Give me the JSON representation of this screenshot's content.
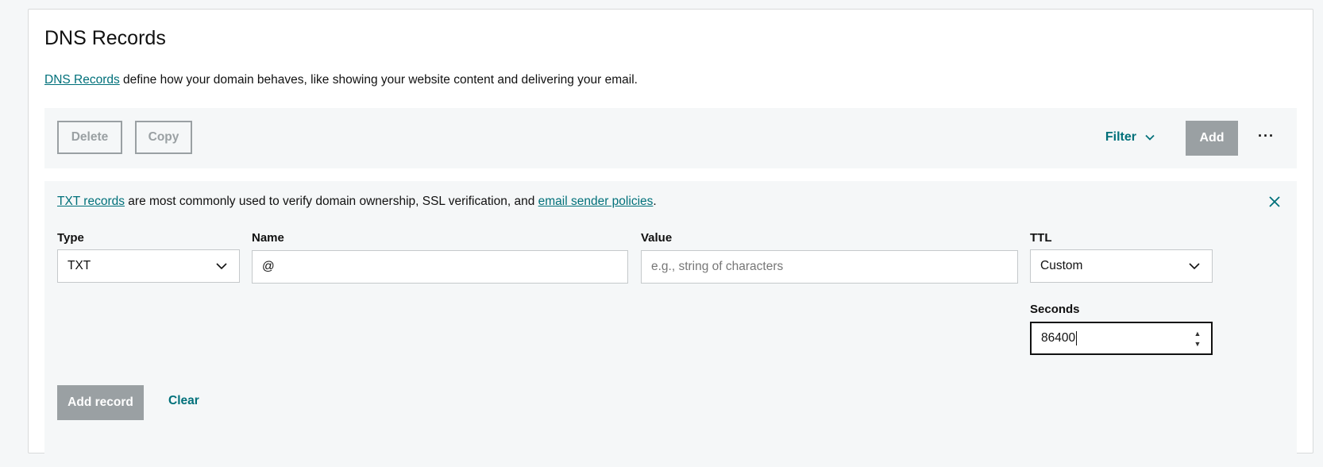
{
  "header": {
    "title": "DNS Records",
    "desc_link": "DNS Records",
    "desc_text": " define how your domain behaves, like showing your website content and delivering your email."
  },
  "toolbar": {
    "delete_label": "Delete",
    "copy_label": "Copy",
    "filter_label": "Filter",
    "add_label": "Add",
    "more_label": "···"
  },
  "banner": {
    "link1": "TXT records",
    "text1": " are most commonly used to verify domain ownership, SSL verification, and ",
    "link2": "email sender policies",
    "text2": "."
  },
  "form": {
    "type_label": "Type",
    "type_value": "TXT",
    "name_label": "Name",
    "name_value": "@",
    "value_label": "Value",
    "value_placeholder": "e.g., string of characters",
    "ttl_label": "TTL",
    "ttl_value": "Custom",
    "seconds_label": "Seconds",
    "seconds_value": "86400",
    "add_record_label": "Add record",
    "clear_label": "Clear"
  },
  "colors": {
    "accent": "#00707a",
    "disabled_button": "#9aa0a3",
    "panel_bg": "#f5f7f8"
  },
  "icons": [
    "chevron-down-icon",
    "close-icon",
    "more-icon",
    "spinner-arrows-icon"
  ]
}
